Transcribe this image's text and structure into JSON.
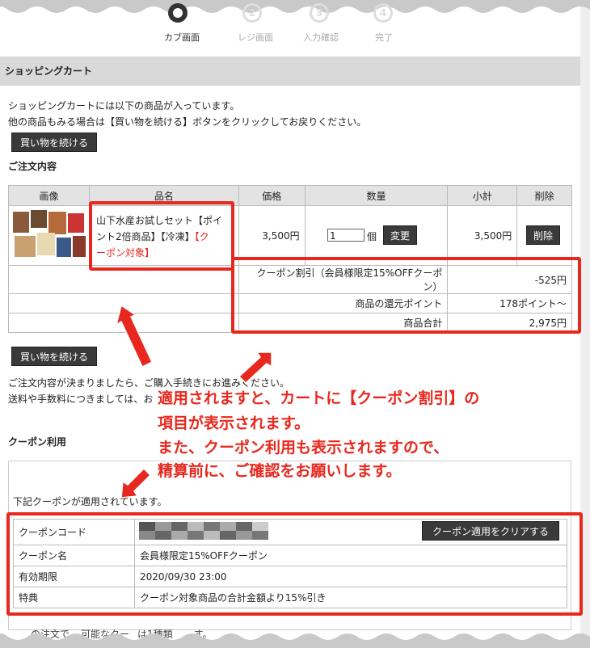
{
  "steps": [
    {
      "label": "カブ画面",
      "num": "1",
      "active": true
    },
    {
      "label": "レジ画面",
      "num": "2",
      "active": false
    },
    {
      "label": "入力確認",
      "num": "3",
      "active": false
    },
    {
      "label": "完了",
      "num": "4",
      "active": false
    }
  ],
  "section_title": "ショッピングカート",
  "intro_line1": "ショッピングカートには以下の商品が入っています。",
  "intro_line2": "他の商品もみる場合は【買い物を続ける】ボタンをクリックしてお戻りください。",
  "continue_button": "買い物を続ける",
  "order_heading": "ご注文内容",
  "cart": {
    "headers": {
      "image": "画像",
      "name": "品名",
      "price": "価格",
      "qty": "数量",
      "subtotal": "小計",
      "delete": "削除"
    },
    "item": {
      "name": "山下水産お試しセット【ポイント2倍商品】【冷凍】",
      "name_line1": "山下水産お試しセット【ポイ",
      "name_line2": "ント2倍商品】【冷凍】",
      "coupon_tag_a": "【ク",
      "coupon_tag_b": "ーポン対象】",
      "price": "3,500円",
      "qty_value": "1",
      "qty_unit": "個",
      "change_button": "変更",
      "subtotal": "3,500円",
      "delete_button": "削除"
    },
    "summary": [
      {
        "label": "クーポン割引（会員様限定15%OFFクーポン）",
        "value": "-525円"
      },
      {
        "label": "商品の還元ポイント",
        "value": "178ポイント〜"
      },
      {
        "label": "商品合計",
        "value": "2,975円"
      }
    ]
  },
  "continue_button_2": "買い物を続ける",
  "proceed_line1": "ご注文内容が決まりましたら、ご購入手続きにお進みください。",
  "proceed_line2": "送料や手数料につきましては、お",
  "coupon_section_title": "クーポン利用",
  "coupon_applied_text": "下記クーポンが適用されています。",
  "coupon_table": {
    "code_label": "クーポンコード",
    "clear_button": "クーポン適用をクリアする",
    "name_label": "クーポン名",
    "name_value": "会員様限定15%OFFクーポン",
    "expiry_label": "有効期限",
    "expiry_value": "2020/09/30 23:00",
    "benefit_label": "特典",
    "benefit_value": "クーポン対象商品の合計金額より15%引き"
  },
  "bottom_partial": "の注文で",
  "bottom_partial_2": "可能なクー",
  "bottom_partial_3": "は1種類",
  "bottom_partial_4": "す。",
  "annotation": {
    "line1": "適用されますと、カートに【クーポン割引】の",
    "line2": "項目が表示されます。",
    "line3": "また、クーポン利用も表示されますので、",
    "line4": "精算前に、ご確認をお願いします。"
  },
  "colors": {
    "annotation_red": "#e8281e",
    "button_dark": "#3a3a3a",
    "header_gray": "#d9d9d9"
  }
}
